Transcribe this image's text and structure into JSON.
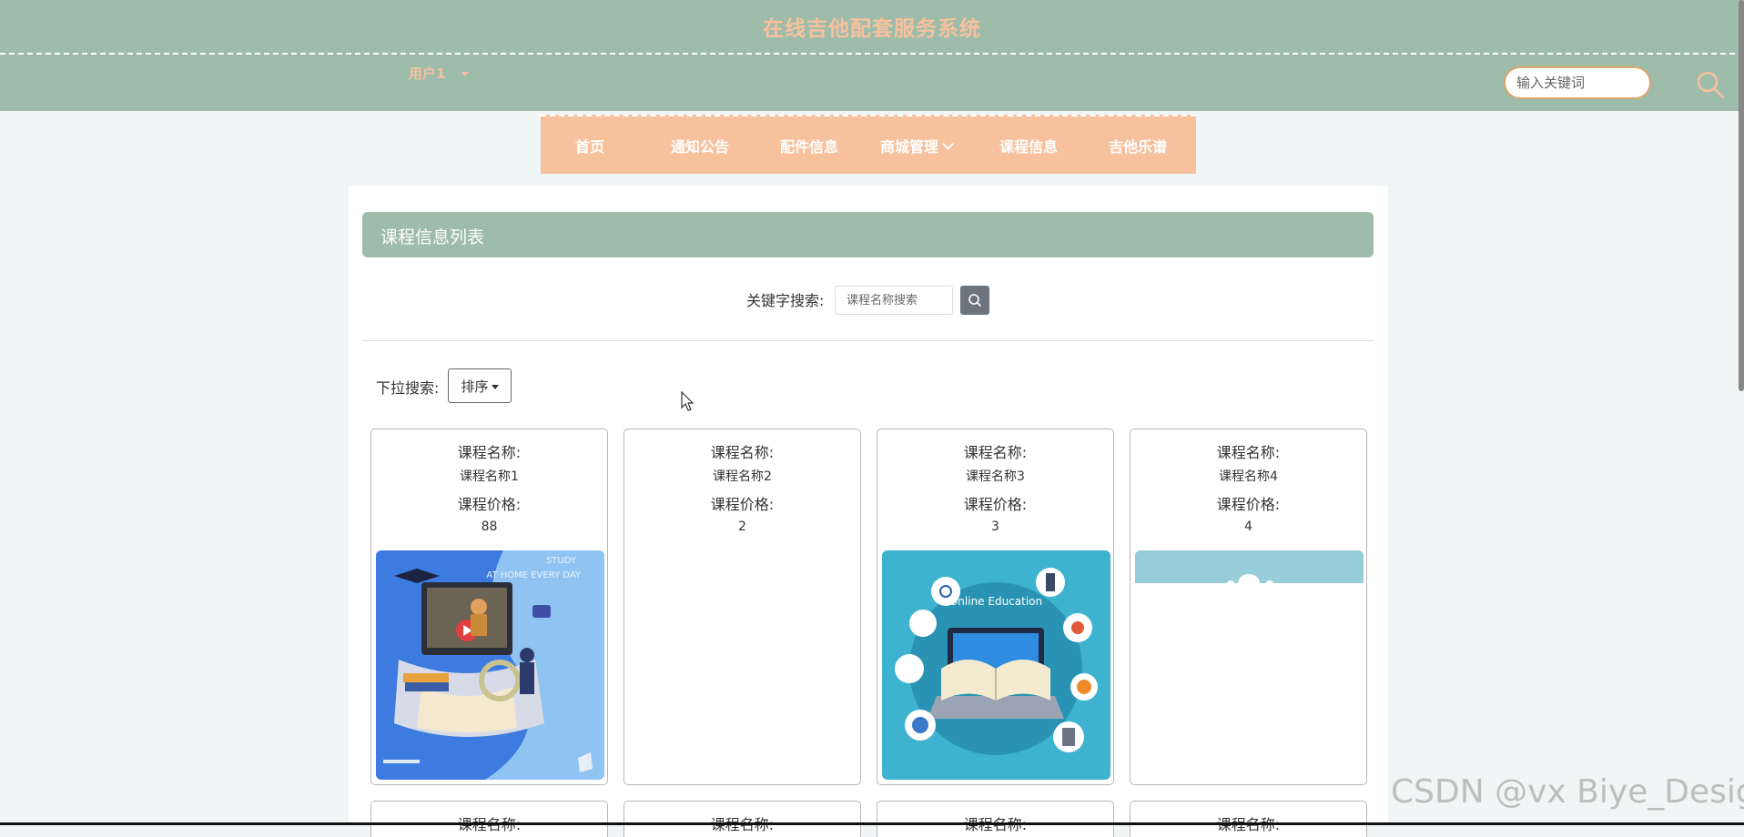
{
  "header": {
    "title": "在线吉他配套服务系统",
    "user": "用户1",
    "search_placeholder": "输入关键词"
  },
  "nav": {
    "items": [
      "首页",
      "通知公告",
      "配件信息",
      "商城管理",
      "课程信息",
      "吉他乐谱"
    ]
  },
  "list": {
    "title": "课程信息列表",
    "keyword_label": "关键字搜索:",
    "keyword_placeholder": "课程名称搜索",
    "dropdown_label": "下拉搜索:",
    "sort_label": "排序"
  },
  "cards": [
    {
      "name_label": "课程名称:",
      "name": "课程名称1",
      "price_label": "课程价格:",
      "price": "88",
      "image": "online-study-illustration"
    },
    {
      "name_label": "课程名称:",
      "name": "课程名称2",
      "price_label": "课程价格:",
      "price": "2",
      "image": "none"
    },
    {
      "name_label": "课程名称:",
      "name": "课程名称3",
      "price_label": "课程价格:",
      "price": "3",
      "image": "online-education-illustration",
      "image_text": "Online Education"
    },
    {
      "name_label": "课程名称:",
      "name": "课程名称4",
      "price_label": "课程价格:",
      "price": "4",
      "image": "partially-loaded-image"
    }
  ],
  "card1_image_text": {
    "line1": "STUDY",
    "line2": "AT HOME EVERY DAY"
  },
  "next_row_label": "课程名称:",
  "watermark": "CSDN @vx Biye_Design",
  "colors": {
    "header": "#9ebcaa",
    "accent": "#f7c19d",
    "search_border": "#e0a66b"
  }
}
